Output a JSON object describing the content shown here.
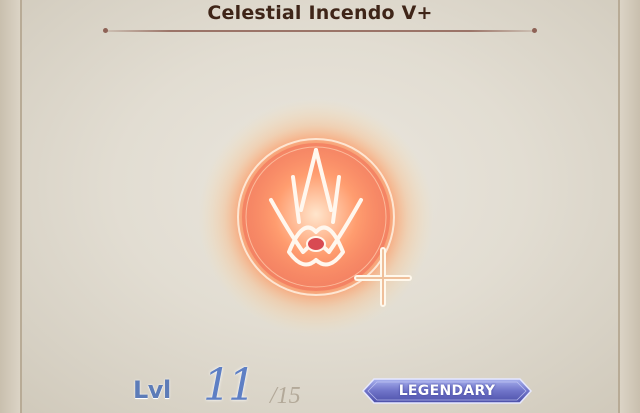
{
  "skill": {
    "name": "Celestial Incendo V+",
    "icon": "fire-sigil-plus-icon"
  },
  "level": {
    "label": "Lvl",
    "current": "11",
    "max": "/15"
  },
  "rarity": {
    "label": "LEGENDARY",
    "color": "#6f73c8"
  },
  "colors": {
    "title": "#3f2518",
    "level": "#5e7fc4",
    "glow": "#ff8a55"
  }
}
